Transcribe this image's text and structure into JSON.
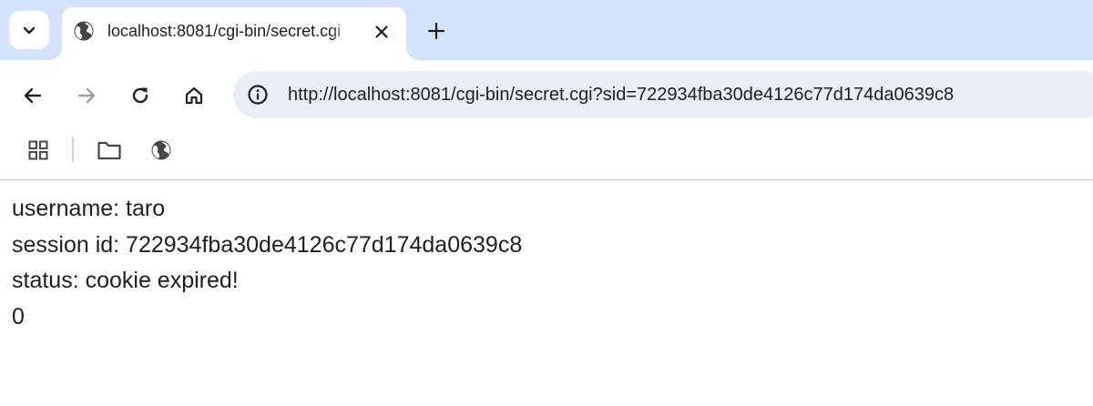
{
  "tab": {
    "title": "localhost:8081/cgi-bin/secret.cgi"
  },
  "omnibox": {
    "url": "http://localhost:8081/cgi-bin/secret.cgi?sid=722934fba30de4126c77d174da0639c8"
  },
  "page": {
    "lines": [
      "username: taro",
      "session id: 722934fba30de4126c77d174da0639c8",
      "status: cookie expired!",
      "0"
    ]
  },
  "icons": {
    "tab_search": "chevron-down-icon",
    "favicon": "globe-icon",
    "close": "close-icon",
    "new_tab": "plus-icon",
    "back": "arrow-left-icon",
    "forward": "arrow-right-icon",
    "reload": "reload-icon",
    "home": "home-icon",
    "site_info": "info-icon",
    "apps": "apps-grid-icon",
    "folder": "folder-icon",
    "bookmark_site": "globe-icon"
  },
  "colors": {
    "tabstrip": "#d3e3fd",
    "omnibox": "#e9eef6",
    "text": "#1f1f1f",
    "forward_disabled": "#9aa0a6"
  }
}
